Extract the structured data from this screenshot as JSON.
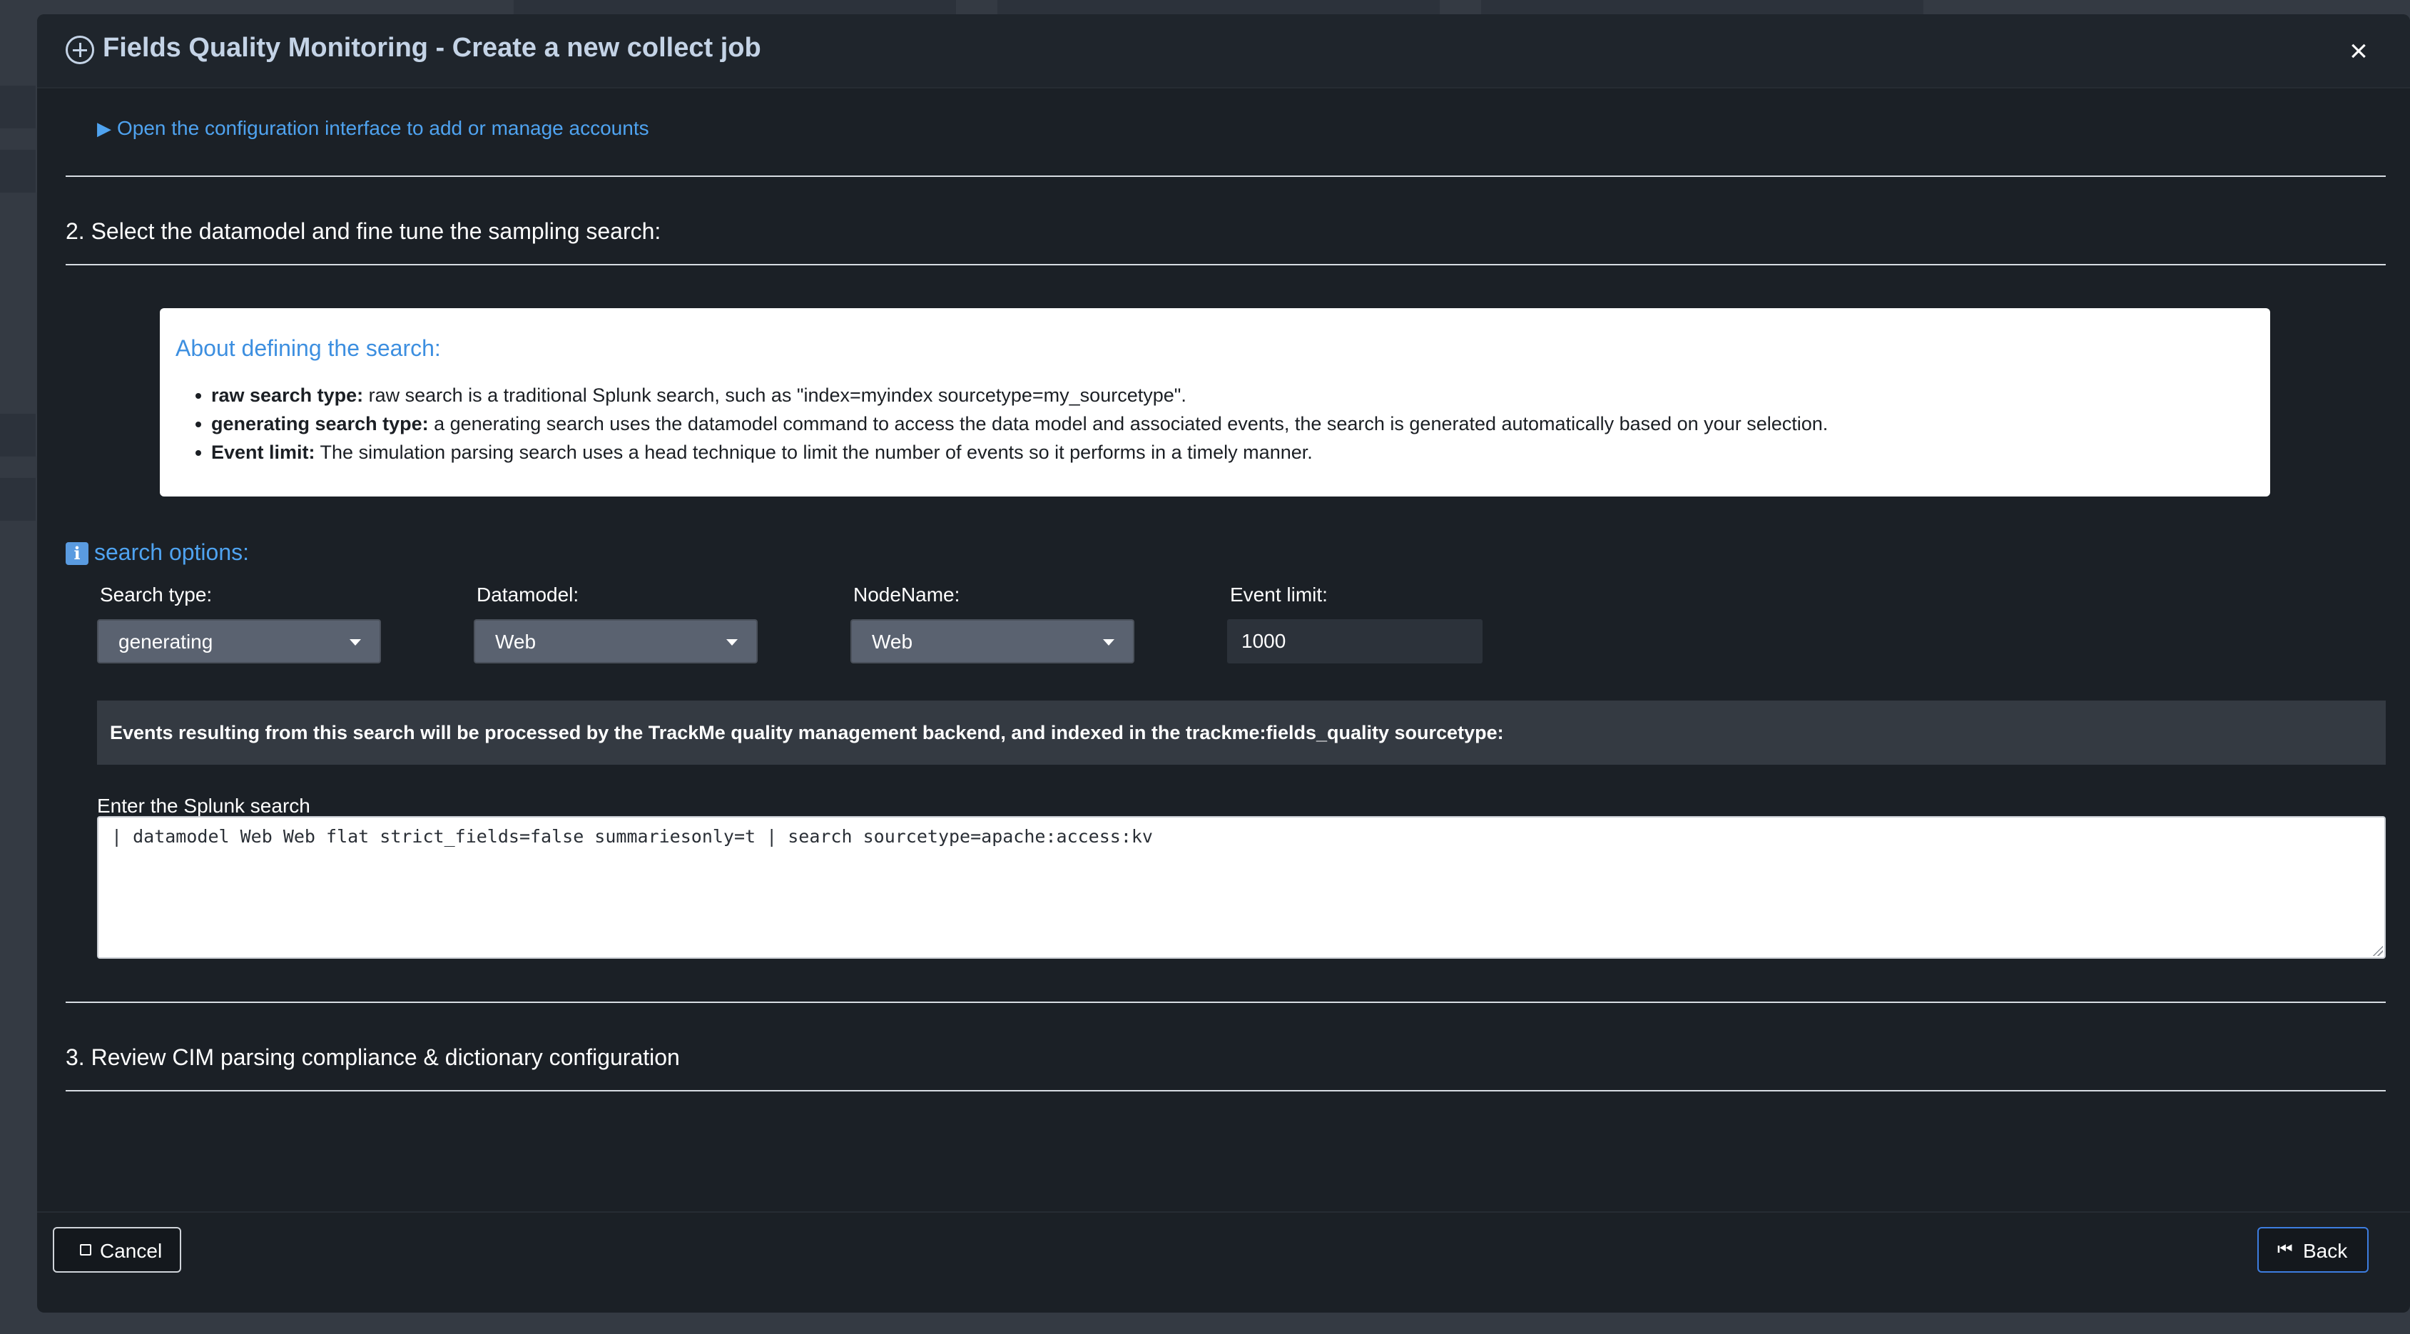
{
  "modal": {
    "title": "Fields Quality Monitoring - Create a new collect job",
    "close_label": "×",
    "config_link": "Open the configuration interface to add or manage accounts"
  },
  "section2": {
    "title": "2. Select the datamodel and fine tune the sampling search:"
  },
  "about": {
    "title": "About defining the search:",
    "items": [
      {
        "bold": "raw search type:",
        "text": " raw search is a traditional Splunk search, such as \"index=myindex sourcetype=my_sourcetype\"."
      },
      {
        "bold": "generating search type:",
        "text": " a generating search uses the datamodel command to access the data model and associated events, the search is generated automatically based on your selection."
      },
      {
        "bold": "Event limit:",
        "text": " The simulation parsing search uses a head technique to limit the number of events so it performs in a timely manner."
      }
    ]
  },
  "options": {
    "info_icon": "i",
    "title": "search options:",
    "search_type": {
      "label": "Search type:",
      "value": "generating"
    },
    "datamodel": {
      "label": "Datamodel:",
      "value": "Web"
    },
    "nodename": {
      "label": "NodeName:",
      "value": "Web"
    },
    "event_limit": {
      "label": "Event limit:",
      "value": "1000"
    }
  },
  "notice": "Events resulting from this search will be processed by the TrackMe quality management backend, and indexed in the trackme:fields_quality sourcetype:",
  "splunk_search": {
    "label": "Enter the Splunk search",
    "value": "| datamodel Web Web flat strict_fields=false summariesonly=t | search sourcetype=apache:access:kv"
  },
  "section3": {
    "title": "3. Review CIM parsing compliance & dictionary configuration"
  },
  "footer": {
    "cancel_label": "Cancel",
    "back_label": "Back",
    "back_icon": "⏮"
  },
  "colors": {
    "accent": "#4fa3f0",
    "modal_bg": "#1b2026",
    "back_border": "#3d7de0"
  }
}
